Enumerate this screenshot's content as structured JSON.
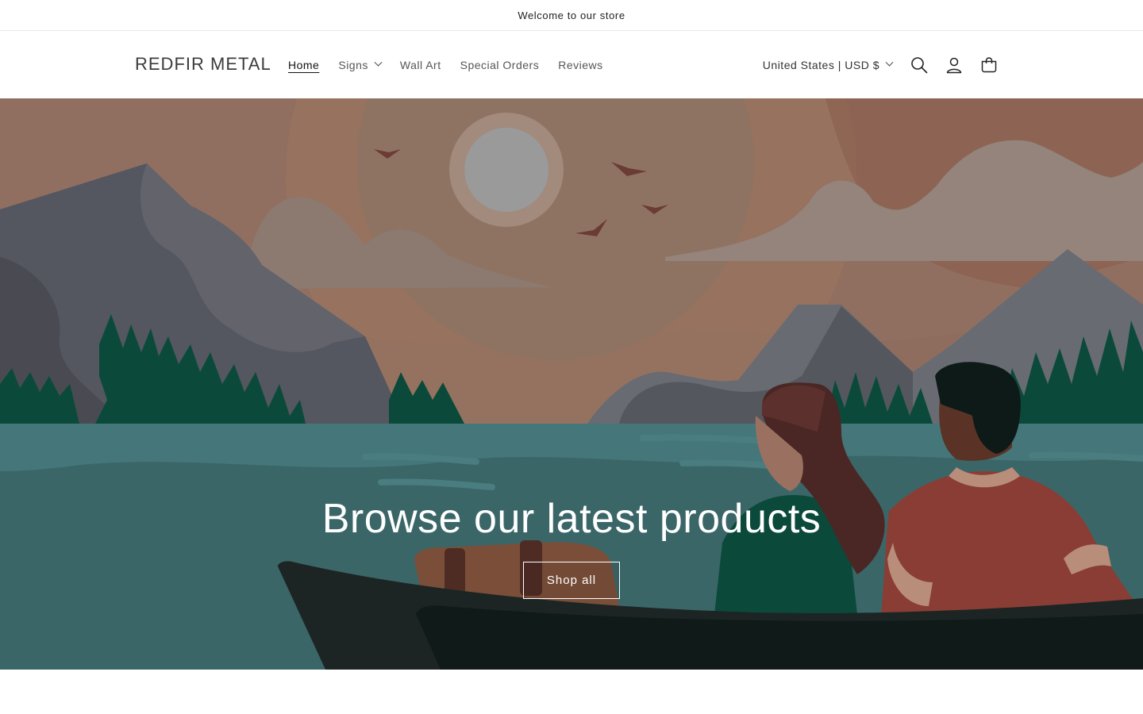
{
  "announcement": {
    "text": "Welcome to our store"
  },
  "header": {
    "logo": "REDFIR METAL",
    "nav": [
      {
        "label": "Home",
        "active": true
      },
      {
        "label": "Signs",
        "has_dropdown": true
      },
      {
        "label": "Wall Art"
      },
      {
        "label": "Special Orders"
      },
      {
        "label": "Reviews"
      }
    ],
    "country_selector": "United States | USD $",
    "icons": [
      "search-icon",
      "account-icon",
      "cart-icon"
    ]
  },
  "hero": {
    "heading": "Browse our latest products",
    "button_label": "Shop all"
  },
  "colors": {
    "sky": "#8c6e5e",
    "water": "#3c6a6c",
    "boat": "#1c2524",
    "trees": "#0b4a3a"
  }
}
